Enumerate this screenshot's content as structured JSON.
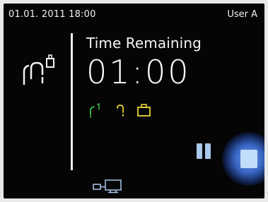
{
  "status_bar": {
    "datetime": "01.01. 2011 18:00",
    "user": "User A"
  },
  "main": {
    "title": "Time Remaining",
    "timer": "01:00",
    "program_icon": "program-icon",
    "phase_icons": [
      {
        "name": "phase-1-icon",
        "color": "#35c04a"
      },
      {
        "name": "phase-2-icon",
        "color": "#e6d23a"
      },
      {
        "name": "phase-3-icon",
        "color": "#e6d23a"
      }
    ]
  },
  "controls": {
    "pause_icon": "pause-icon",
    "stop_icon": "stop-icon",
    "accent": "#4f8cff"
  },
  "footer": {
    "connection_icon": "connection-icon"
  },
  "colors": {
    "background": "#050505",
    "text": "#ffffff",
    "pause": "#a9c8ea",
    "stop": "#c2dcfb"
  }
}
